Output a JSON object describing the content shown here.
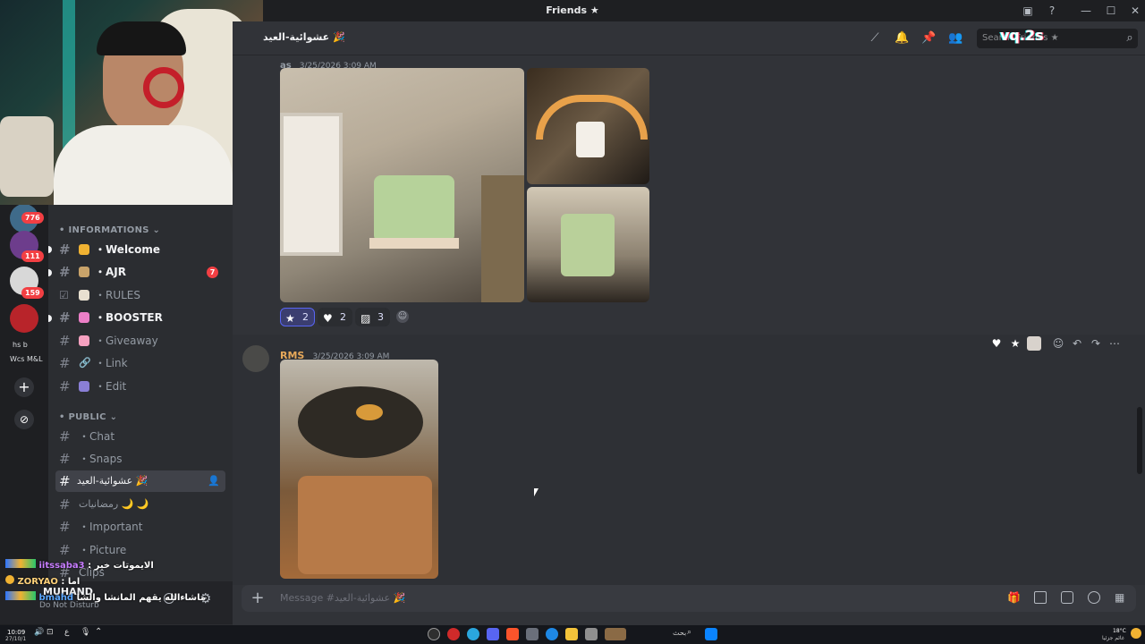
{
  "window": {
    "title": "Friends ★",
    "min": "—",
    "max": "☐",
    "close": "✕"
  },
  "header": {
    "channel_name": "عشوائية-العيد 🎉",
    "search_placeholder": "Search Friends ★",
    "watermark": "vq.2s"
  },
  "servers": [
    {
      "badge": "776"
    },
    {
      "badge": "111"
    },
    {
      "badge": "159"
    },
    {
      "label_top": "hs  b",
      "label_bottom": "Wcs M&L"
    }
  ],
  "rail": {
    "add": "+",
    "discover": "⊘"
  },
  "categories": [
    {
      "name": "INFORMATIONS",
      "chevron": "⌄"
    },
    {
      "name": "PUBLIC",
      "chevron": "⌄"
    }
  ],
  "channels": [
    {
      "label": "・Welcome",
      "emoji_color": "#f0b232",
      "bold": true,
      "unread": true
    },
    {
      "label": "・AJR",
      "emoji_color": "#c9a36a",
      "bold": true,
      "unread": true,
      "mentions": "7"
    },
    {
      "label": "・RULES",
      "emoji_color": "#e8e0d0",
      "bold": false
    },
    {
      "label": "・BOOSTER",
      "emoji_color": "#ec7fc7",
      "bold": true,
      "unread": true
    },
    {
      "label": "・Giveaway",
      "emoji_color": "#f6a1c0",
      "bold": false
    },
    {
      "label": "・Link",
      "emoji_color": "#b5bac1",
      "bold": false
    },
    {
      "label": "・Edit",
      "emoji_color": "#8a7fd6",
      "bold": false
    },
    {
      "label": "・Chat",
      "bold": false
    },
    {
      "label": "・Snaps",
      "bold": false
    },
    {
      "label": "عشوائية-العيد 🎉",
      "bold": false,
      "selected": true
    },
    {
      "label": "رمضانيات 🌙 🌙",
      "bold": false
    },
    {
      "label": "・Important",
      "bold": false
    },
    {
      "label": "・Picture",
      "bold": false
    },
    {
      "label": "Clips",
      "bold": false
    }
  ],
  "messages": [
    {
      "author": "as",
      "timestamp": "3/25/2026 3:09 AM",
      "attachments": 3,
      "reactions": [
        {
          "icon": "star-icon",
          "count": "2"
        },
        {
          "icon": "heart-icon",
          "count": "2"
        },
        {
          "icon": "sticker-icon",
          "count": "3"
        }
      ]
    },
    {
      "author": "RMS",
      "timestamp": "3/25/2026 3:09 AM",
      "attachments": 1
    }
  ],
  "composer": {
    "placeholder": "Message #عشوائية-العيد 🎉"
  },
  "user_panel": {
    "name": "MUHAND",
    "status": "Do Not Disturb"
  },
  "stream_chat": [
    {
      "user": "iitssaba3",
      "text": "الايموتات خير",
      "color": "#c77dff"
    },
    {
      "user": "ZORYAO",
      "text": "اما",
      "color": "#ffd27a"
    },
    {
      "user": "bmahd",
      "text": "ماشاءالله يقهم المانشا والشا",
      "color": "#5aa7ff"
    }
  ],
  "taskbar": {
    "time": "10:09",
    "date": "27/10/1",
    "weather": "18°C",
    "weather_desc": "غائم جزئيا",
    "search": "بحث"
  }
}
